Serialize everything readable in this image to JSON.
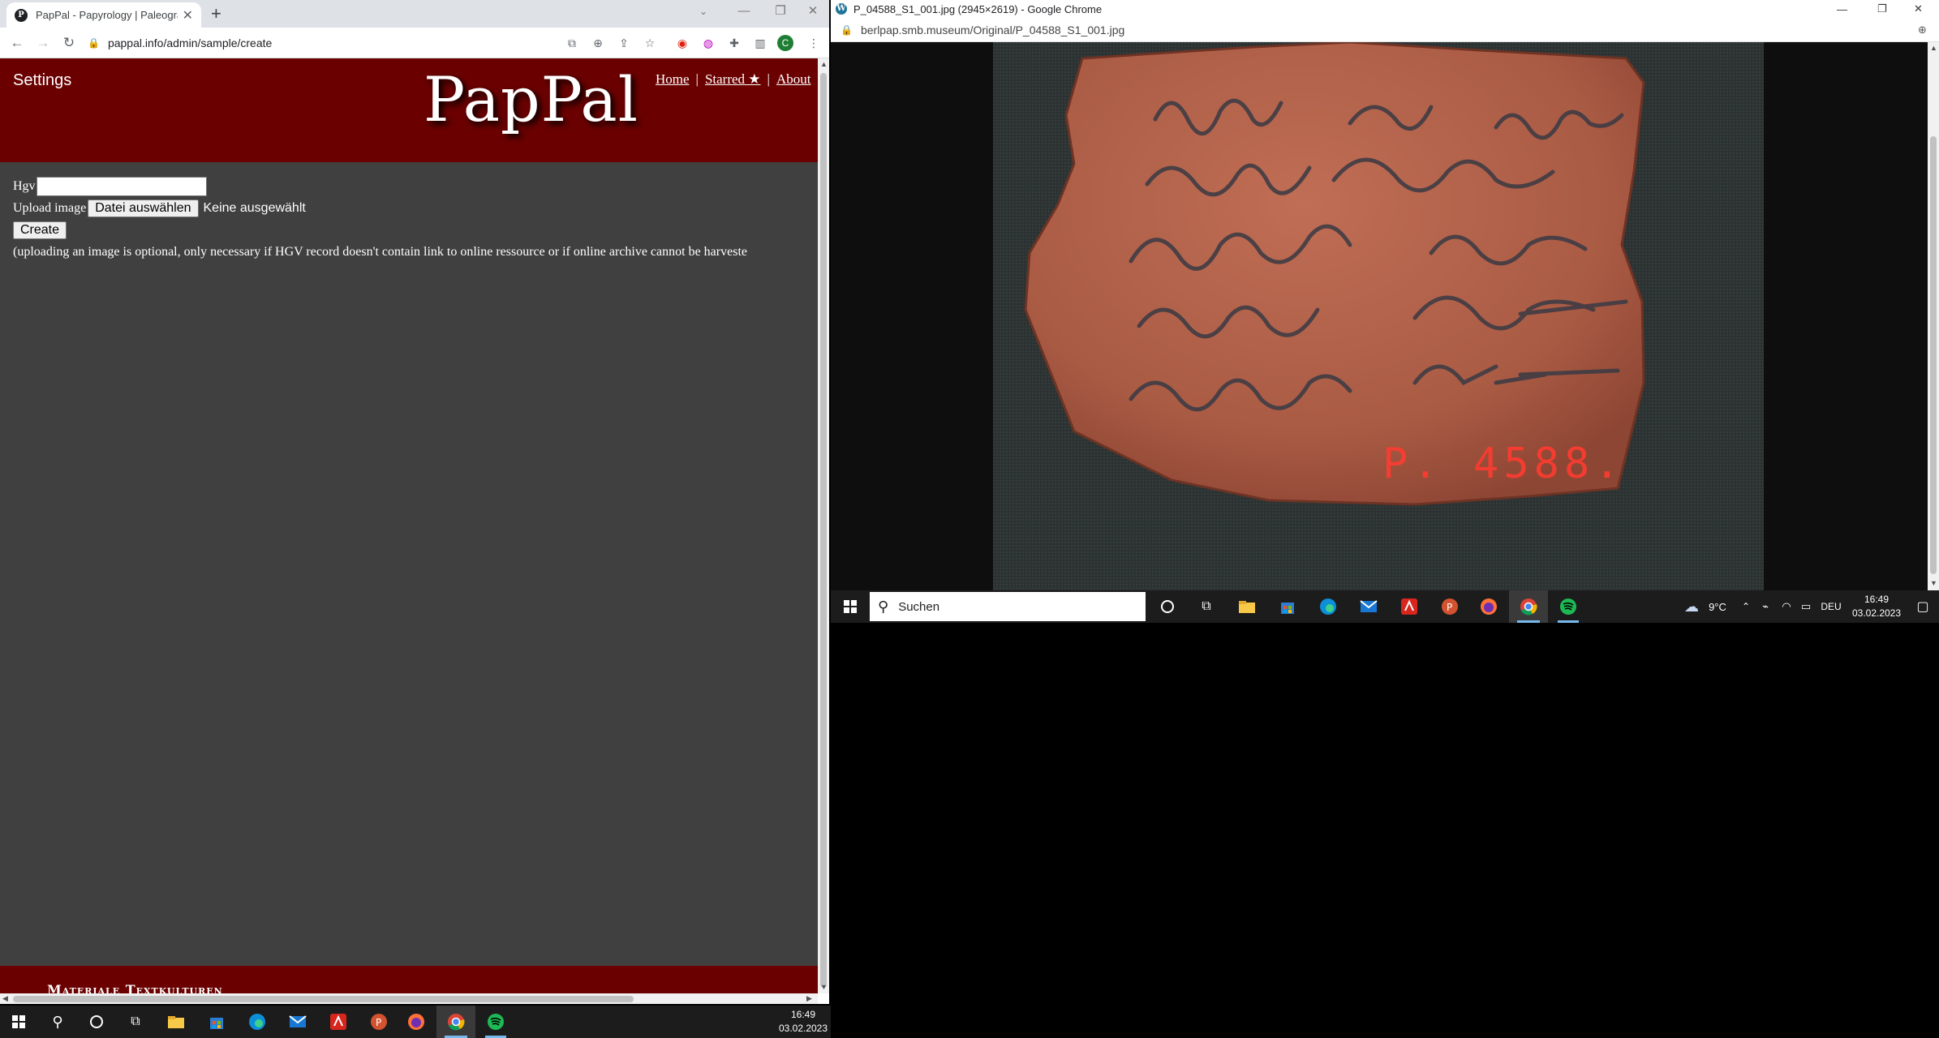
{
  "left_window": {
    "tab_title": "PapPal - Papyrology | Paleograph",
    "url": "pappal.info/admin/sample/create",
    "profile_initial": "C",
    "page": {
      "settings_label": "Settings",
      "logo": "PapPal",
      "nav": {
        "home": "Home",
        "starred": "Starred ★",
        "about": "About",
        "separator": "|"
      },
      "form": {
        "hgv_label": "Hgv",
        "hgv_value": "",
        "upload_label": "Upload image",
        "file_button": "Datei auswählen",
        "file_status": "Keine ausgewählt",
        "create_button": "Create",
        "note": "(uploading an image is optional, only necessary if HGV record doesn't contain link to online ressource or if online archive cannot be harveste"
      },
      "footer_text": "Materiale Textkulturen"
    },
    "taskbar": {
      "time": "16:49",
      "date": "03.02.2023"
    }
  },
  "right_window": {
    "title": "P_04588_S1_001.jpg (2945×2619) - Google Chrome",
    "url": "berlpap.smb.museum/Original/P_04588_S1_001.jpg",
    "image_label": "P. 4588.",
    "taskbar": {
      "search_placeholder": "Suchen",
      "weather": "9°C",
      "language": "DEU",
      "time": "16:49",
      "date": "03.02.2023"
    }
  }
}
